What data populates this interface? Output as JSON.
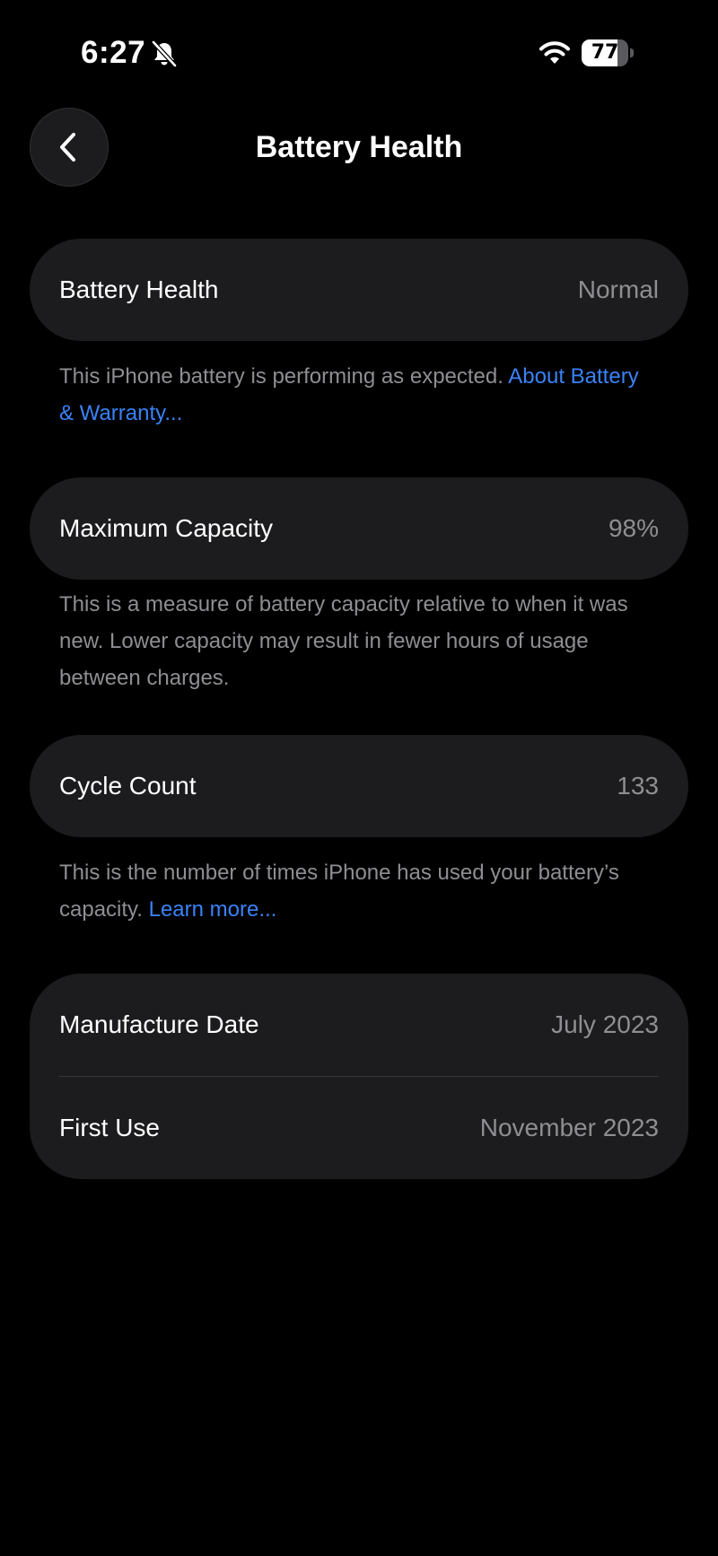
{
  "status_bar": {
    "time": "6:27",
    "battery_level": 77,
    "battery_text": "77",
    "icons": [
      "bell-slash-icon",
      "wifi-icon",
      "battery-icon"
    ]
  },
  "nav": {
    "title": "Battery Health",
    "back_icon": "chevron-left-icon"
  },
  "sections": {
    "health": {
      "label": "Battery Health",
      "value": "Normal",
      "footnote": "This iPhone battery is performing as expected. ",
      "link": "About Battery & Warranty..."
    },
    "capacity": {
      "label": "Maximum Capacity",
      "value": "98%",
      "footnote": "This is a measure of battery capacity relative to when it was new. Lower capacity may result in fewer hours of usage between charges."
    },
    "cycles": {
      "label": "Cycle Count",
      "value": "133",
      "footnote": "This is the number of times iPhone has used your battery’s capacity. ",
      "link": "Learn more..."
    },
    "dates": {
      "manufacture_label": "Manufacture Date",
      "manufacture_value": "July 2023",
      "first_use_label": "First Use",
      "first_use_value": "November 2023"
    }
  },
  "colors": {
    "background": "#000000",
    "card": "#1c1c1e",
    "secondary_text": "#8e8e93",
    "link": "#3a82f7"
  }
}
